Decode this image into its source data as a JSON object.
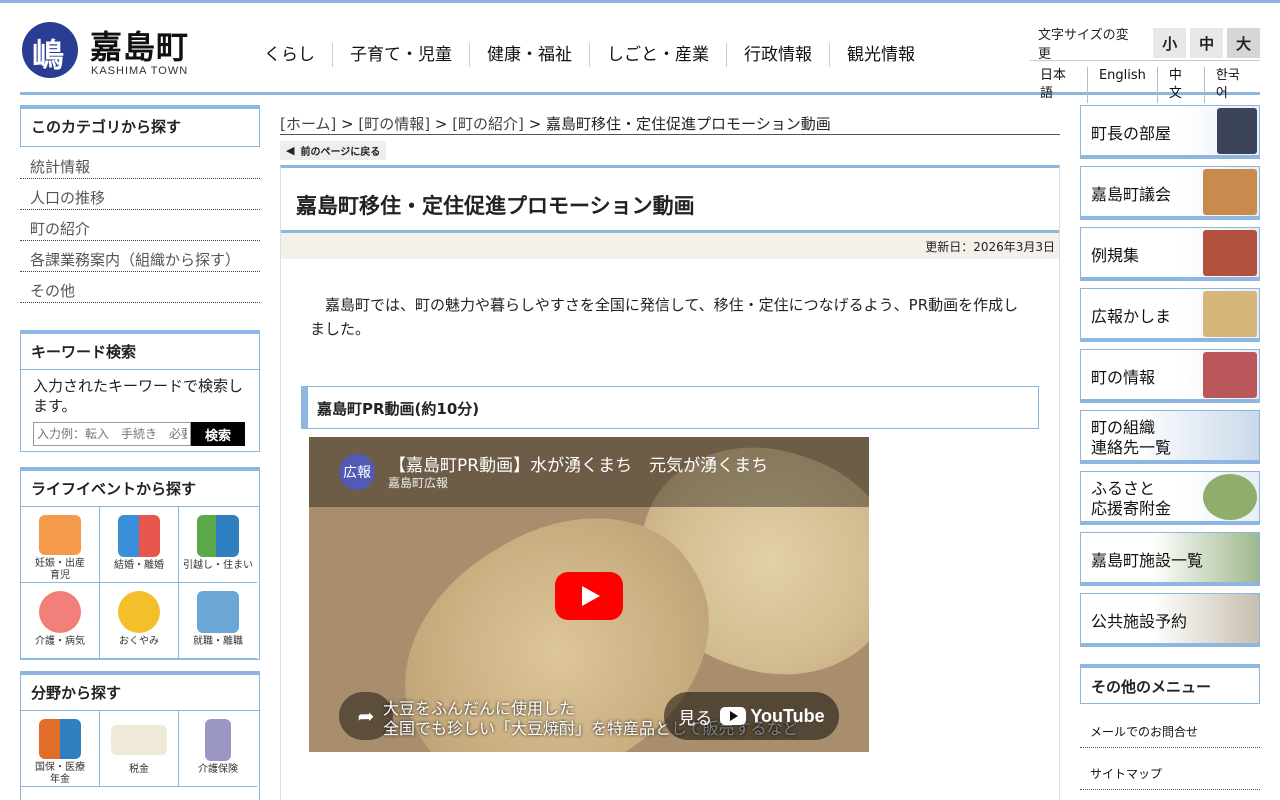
{
  "header": {
    "logo_mark": "嶋",
    "title": "嘉島町",
    "subtitle": "KASHIMA TOWN",
    "nav": [
      "くらし",
      "子育て・児童",
      "健康・福祉",
      "しごと・産業",
      "行政情報",
      "観光情報"
    ],
    "fontsize_label": "文字サイズの変更",
    "fontsize": [
      "小",
      "中",
      "大"
    ],
    "languages": [
      "日本語",
      "English",
      "中文",
      "한국어"
    ]
  },
  "category": {
    "title": "このカテゴリから探す",
    "items": [
      "統計情報",
      "人口の推移",
      "町の紹介",
      "各課業務案内（組織から探す）",
      "その他"
    ]
  },
  "keyword": {
    "title": "キーワード検索",
    "desc": "入力されたキーワードで検索します。",
    "placeholder": "入力例：転入　手続き　必要",
    "button": "検索"
  },
  "life": {
    "title": "ライフイベントから探す",
    "items": [
      "妊娠・出産\n育児",
      "結婚・離婚",
      "引越し・住まい",
      "介護・病気",
      "おくやみ",
      "就職・離職"
    ]
  },
  "field": {
    "title": "分野から探す",
    "items": [
      "国保・医療\n年金",
      "税金",
      "介護保険"
    ]
  },
  "breadcrumb": {
    "home": "[ホーム]",
    "sep": " > ",
    "info": "[町の情報]",
    "intro": "[町の紹介]",
    "current": "嘉島町移住・定住促進プロモーション動画"
  },
  "back_label": "前のページに戻る",
  "article": {
    "title": "嘉島町移住・定住促進プロモーション動画",
    "updated": "更新日：2026年3月3日",
    "body": "嘉島町では、町の魅力や暮らしやすさを全国に発信して、移住・定住につなげるよう、PR動画を作成しました。",
    "h2": "嘉島町PR動画(約10分)"
  },
  "video": {
    "channel_icon": "広報",
    "title": "【嘉島町PR動画】水が湧くまち　元気が湧くまち",
    "channel": "嘉島町広報",
    "subtitle_line1": "大豆をふんだんに使用した",
    "subtitle_line2": "全国でも珍しい「大豆焼酎」を特産品として販売するなど",
    "watch": "見る",
    "brand": "YouTube"
  },
  "right": {
    "banners": [
      "町長の部屋",
      "嘉島町議会",
      "例規集",
      "広報かしま",
      "町の情報",
      "町の組織\n連絡先一覧",
      "ふるさと\n応援寄附金",
      "嘉島町施設一覧",
      "公共施設予約"
    ],
    "other_title": "その他のメニュー",
    "links": [
      "メールでのお問合せ",
      "サイトマップ"
    ]
  },
  "colors": {
    "accent": "#8db7e0",
    "logo": "#2a3d95",
    "youtube": "#ff0000"
  }
}
